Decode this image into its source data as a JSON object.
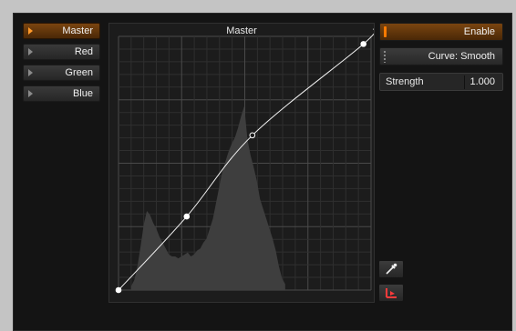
{
  "channels": [
    {
      "label": "Master",
      "active": true
    },
    {
      "label": "Red",
      "active": false
    },
    {
      "label": "Green",
      "active": false
    },
    {
      "label": "Blue",
      "active": false
    }
  ],
  "graph": {
    "title": "Master",
    "control_points": [
      [
        0.0,
        0.0
      ],
      [
        0.27,
        0.29
      ],
      [
        0.53,
        0.61
      ],
      [
        0.97,
        0.97
      ]
    ],
    "histogram": [
      0.02,
      0.05,
      0.12,
      0.22,
      0.33,
      0.4,
      0.38,
      0.34,
      0.31,
      0.27,
      0.24,
      0.21,
      0.18,
      0.17,
      0.17,
      0.16,
      0.17,
      0.18,
      0.19,
      0.17,
      0.18,
      0.2,
      0.21,
      0.24,
      0.26,
      0.31,
      0.36,
      0.44,
      0.52,
      0.6,
      0.65,
      0.7,
      0.74,
      0.77,
      0.82,
      0.88,
      0.93,
      0.76,
      0.68,
      0.62,
      0.55,
      0.46,
      0.41,
      0.36,
      0.31,
      0.26,
      0.2,
      0.12,
      0.06,
      0.03
    ]
  },
  "controls": {
    "enable_label": "Enable",
    "curve_label": "Curve: Smooth",
    "strength_label": "Strength",
    "strength_value": "1.000"
  },
  "colors": {
    "accent": "#ff8a1e",
    "active_button": "#6b3d0d",
    "background": "#141414"
  },
  "icons": {
    "picker": "eyedropper-icon",
    "reset": "reset-curve-icon"
  }
}
